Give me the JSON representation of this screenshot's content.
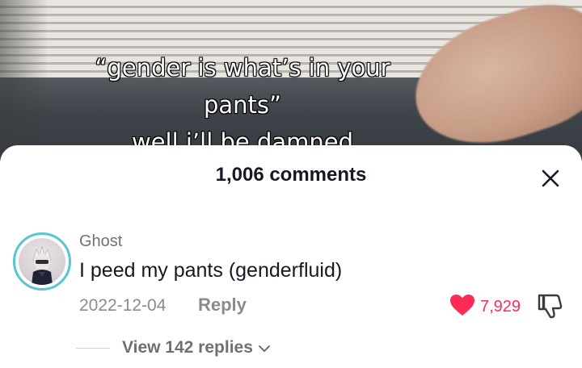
{
  "video": {
    "caption_line1": "“gender is what’s in your",
    "caption_line2": "pants”",
    "caption_line3": "well i’ll be damned"
  },
  "comments_panel": {
    "title": "1,006 comments",
    "close_icon": "close-icon"
  },
  "comment": {
    "username": "Ghost",
    "text": "I peed my pants (genderfluid)",
    "date": "2022-12-04",
    "reply_label": "Reply",
    "like_count": "7,929",
    "liked": true,
    "like_color": "#fe2c55",
    "view_replies_label": "View 142 replies",
    "avatar_ring_color": "#58c6d2"
  }
}
